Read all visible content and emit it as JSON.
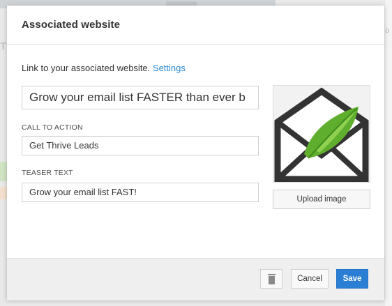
{
  "background": {
    "left_text": "Th",
    "right_text": "o"
  },
  "modal": {
    "title": "Associated website",
    "intro_text": "Link to your associated website.",
    "intro_link": "Settings",
    "title_field": {
      "value": "Grow your email list FASTER than ever b"
    },
    "cta": {
      "label": "CALL TO ACTION",
      "value": "Get Thrive Leads"
    },
    "teaser": {
      "label": "TEASER TEXT",
      "value": "Grow your email list FAST!"
    },
    "image": {
      "icon": "envelope-leaf-logo-icon"
    },
    "upload_label": "Upload image"
  },
  "footer": {
    "delete_icon": "trash-icon",
    "cancel_label": "Cancel",
    "save_label": "Save"
  },
  "colors": {
    "accent": "#2a7fd4",
    "link": "#2a8bd6",
    "leaf_green": "#5fae2e",
    "envelope_dark": "#333333"
  }
}
